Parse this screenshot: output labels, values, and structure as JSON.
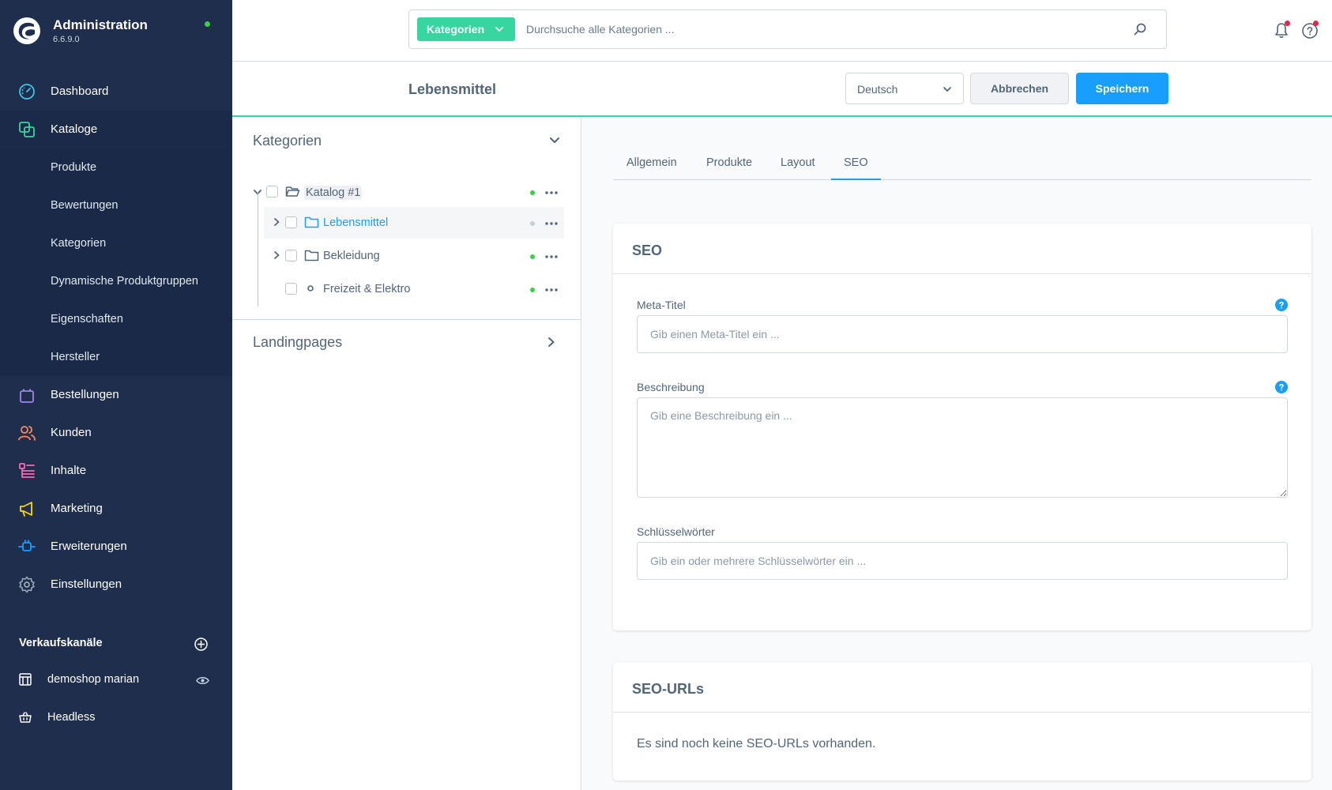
{
  "app": {
    "title": "Administration",
    "version": "6.6.9.0"
  },
  "nav": {
    "dashboard": "Dashboard",
    "kataloge": "Kataloge",
    "kataloge_sub": [
      "Produkte",
      "Bewertungen",
      "Kategorien",
      "Dynamische Produktgruppen",
      "Eigenschaften",
      "Hersteller"
    ],
    "bestellungen": "Bestellungen",
    "kunden": "Kunden",
    "inhalte": "Inhalte",
    "marketing": "Marketing",
    "erweiterungen": "Erweiterungen",
    "einstellungen": "Einstellungen"
  },
  "sales_channels": {
    "heading": "Verkaufskanäle",
    "items": [
      "demoshop marian",
      "Headless"
    ]
  },
  "search": {
    "type_label": "Kategorien",
    "placeholder": "Durchsuche alle Kategorien ..."
  },
  "smartbar": {
    "title": "Lebensmittel",
    "language": "Deutsch",
    "cancel_label": "Abbrechen",
    "save_label": "Speichern"
  },
  "tree": {
    "heading": "Kategorien",
    "root": "Katalog #1",
    "items": [
      "Lebensmittel",
      "Bekleidung",
      "Freizeit & Elektro"
    ],
    "landingpages": "Landingpages"
  },
  "tabs": [
    "Allgemein",
    "Produkte",
    "Layout",
    "SEO"
  ],
  "active_tab": "SEO",
  "seo_card": {
    "title": "SEO",
    "meta_title_label": "Meta-Titel",
    "meta_title_placeholder": "Gib einen Meta-Titel ein ...",
    "description_label": "Beschreibung",
    "description_placeholder": "Gib eine Beschreibung ein ...",
    "keywords_label": "Schlüsselwörter",
    "keywords_placeholder": "Gib ein oder mehrere Schlüsselwörter ein ..."
  },
  "seo_urls_card": {
    "title": "SEO-URLs",
    "empty_text": "Es sind noch keine SEO-URLs vorhanden."
  },
  "colors": {
    "sidebar_bg": "#1e2e4c",
    "accent_blue": "#189eff",
    "accent_green": "#37d6a0",
    "status_green": "#37d046",
    "status_gray": "#c8cfd6",
    "notification_red": "#de294c"
  }
}
